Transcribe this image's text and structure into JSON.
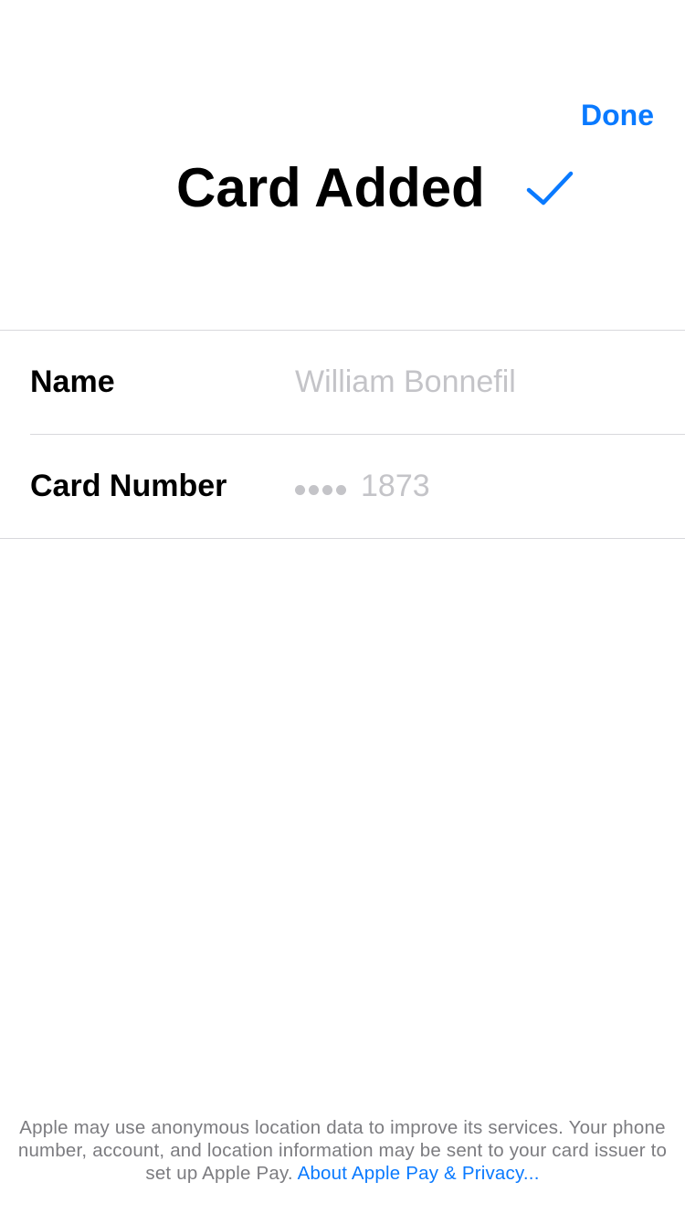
{
  "header": {
    "done_label": "Done",
    "title": "Card Added",
    "check_icon": "checkmark-icon",
    "accent_color": "#0a7aff"
  },
  "form": {
    "rows": [
      {
        "label": "Name",
        "value": "William Bonnefil"
      },
      {
        "label": "Card Number",
        "masked_prefix": "••••",
        "value": "1873"
      }
    ]
  },
  "footer": {
    "text": "Apple may use anonymous location data to improve its services. Your phone number, account, and location information may be sent to your card issuer to set up Apple Pay.",
    "link": "About Apple Pay & Privacy..."
  }
}
